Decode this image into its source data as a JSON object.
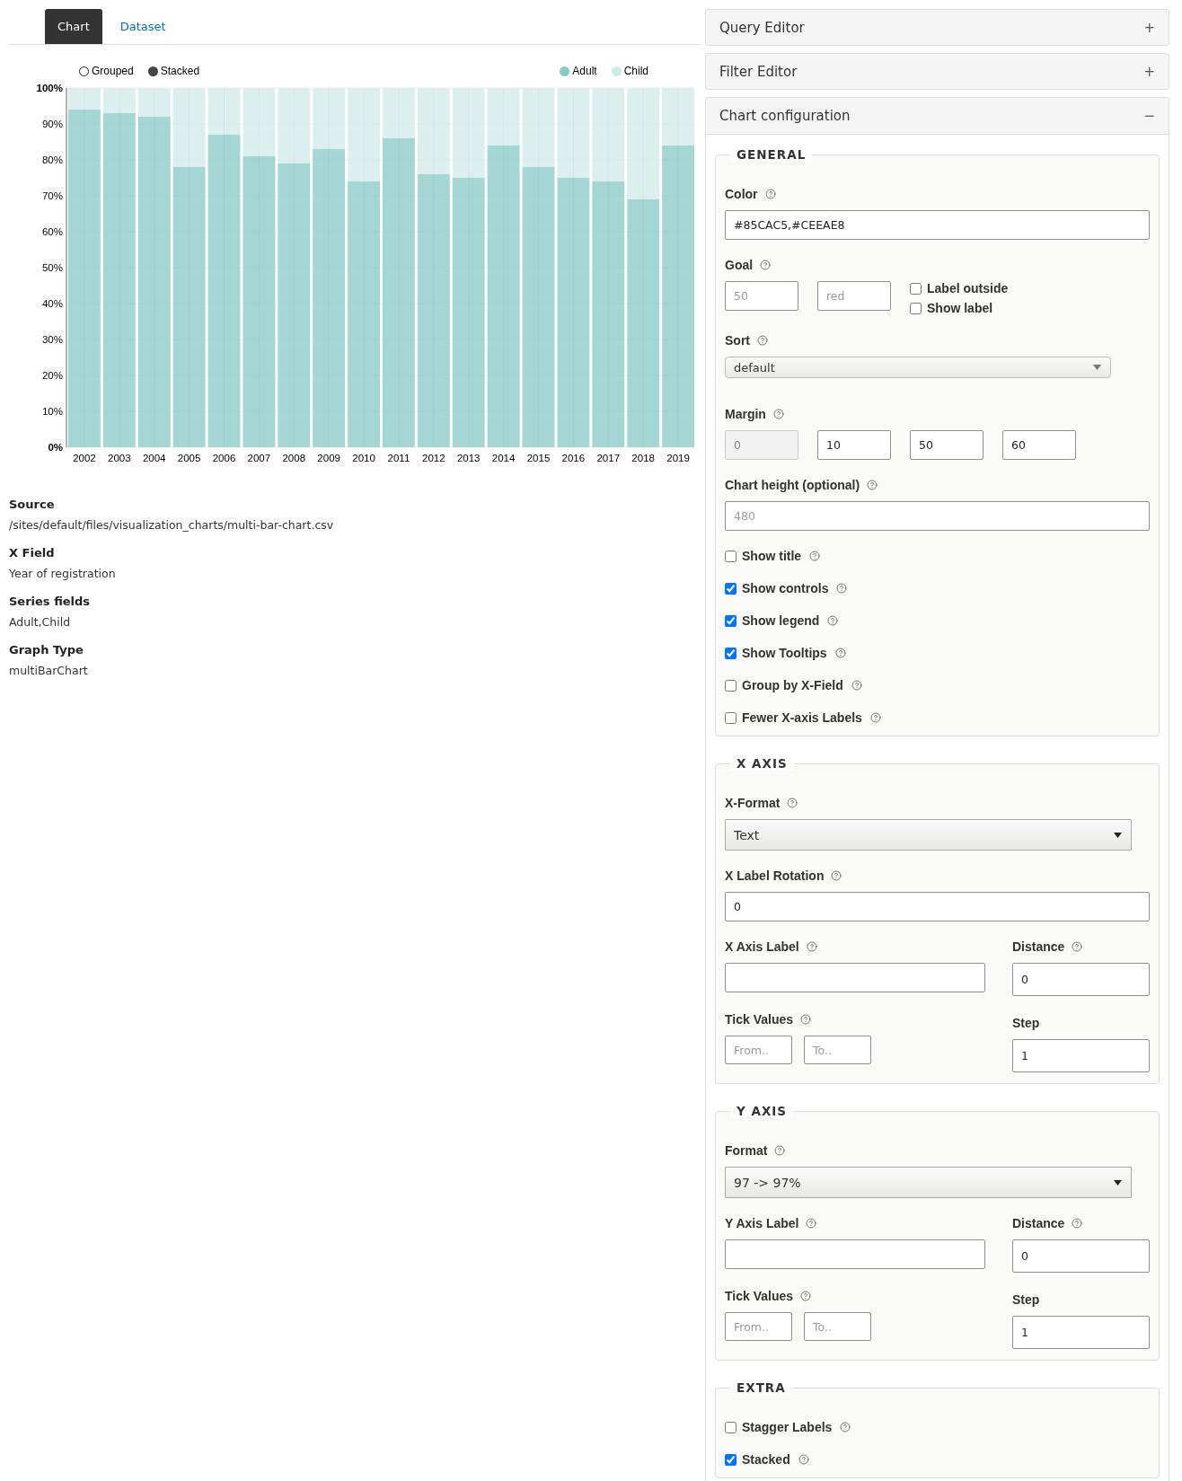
{
  "tabs": [
    {
      "label": "Chart",
      "selected": true
    },
    {
      "label": "Dataset",
      "selected": false
    }
  ],
  "chart": {
    "controls": [
      {
        "label": "Grouped",
        "selected": false
      },
      {
        "label": "Stacked",
        "selected": true
      }
    ],
    "chart_data": {
      "type": "bar",
      "categories": [
        "2002",
        "2003",
        "2004",
        "2005",
        "2006",
        "2007",
        "2008",
        "2009",
        "2010",
        "2011",
        "2012",
        "2013",
        "2014",
        "2015",
        "2016",
        "2017",
        "2018",
        "2019"
      ],
      "series": [
        {
          "name": "Adult",
          "color": "#85cac5",
          "values": [
            94,
            93,
            92,
            78,
            87,
            81,
            79,
            83,
            74,
            86,
            76,
            75,
            84,
            78,
            75,
            74,
            69,
            84
          ]
        },
        {
          "name": "Child",
          "color": "#ceeae8",
          "values": [
            6,
            7,
            8,
            22,
            13,
            19,
            21,
            17,
            26,
            14,
            24,
            25,
            16,
            22,
            25,
            26,
            31,
            16
          ]
        }
      ],
      "stacked": true,
      "grid": true,
      "ylim": [
        0,
        100
      ],
      "yticks": [
        {
          "value": 0,
          "label": "0%"
        },
        {
          "value": 10,
          "label": "10%"
        },
        {
          "value": 20,
          "label": "20%"
        },
        {
          "value": 30,
          "label": "30%"
        },
        {
          "value": 40,
          "label": "40%"
        },
        {
          "value": 50,
          "label": "50%"
        },
        {
          "value": 60,
          "label": "60%"
        },
        {
          "value": 70,
          "label": "70%"
        },
        {
          "value": 80,
          "label": "80%"
        },
        {
          "value": 90,
          "label": "90%"
        },
        {
          "value": 100,
          "label": "100%"
        }
      ]
    }
  },
  "details": [
    {
      "label": "Source",
      "value": "/sites/default/files/visualization_charts/multi-bar-chart.csv"
    },
    {
      "label": "X Field",
      "value": "Year of registration"
    },
    {
      "label": "Series fields",
      "value": "Adult,Child"
    },
    {
      "label": "Graph Type",
      "value": "multiBarChart"
    }
  ],
  "accordions": [
    {
      "title": "Query Editor",
      "toggle": "+",
      "expanded": false
    },
    {
      "title": "Filter Editor",
      "toggle": "+",
      "expanded": false
    },
    {
      "title": "Chart configuration",
      "toggle": "−",
      "expanded": true
    }
  ],
  "sections": [
    {
      "title": "GENERAL",
      "items": [
        {
          "kind": "input",
          "label": "Color",
          "help": true,
          "value": "#85CAC5,#CEEAE8"
        },
        {
          "kind": "goal",
          "label": "Goal",
          "help": true,
          "inputs": [
            {
              "placeholder": "50"
            },
            {
              "placeholder": "red"
            }
          ],
          "checks": [
            {
              "label": "Label outside",
              "checked": false
            },
            {
              "label": "Show label",
              "checked": false
            }
          ]
        },
        {
          "kind": "compact-select",
          "label": "Sort",
          "help": true,
          "value": "default"
        },
        {
          "kind": "margin",
          "label": "Margin",
          "help": true,
          "inputs": [
            {
              "value": "0",
              "disabled": true
            },
            {
              "value": "10",
              "disabled": false
            },
            {
              "value": "50",
              "disabled": false
            },
            {
              "value": "60",
              "disabled": false
            }
          ]
        },
        {
          "kind": "input",
          "label": "Chart height (optional)",
          "help": true,
          "placeholder": "480"
        },
        {
          "kind": "checkbox",
          "label": "Show title",
          "help": true,
          "checked": false
        },
        {
          "kind": "checkbox",
          "label": "Show controls",
          "help": true,
          "checked": true
        },
        {
          "kind": "checkbox",
          "label": "Show legend",
          "help": true,
          "checked": true
        },
        {
          "kind": "checkbox",
          "label": "Show Tooltips",
          "help": true,
          "checked": true
        },
        {
          "kind": "checkbox",
          "label": "Group by X-Field",
          "help": true,
          "checked": false
        },
        {
          "kind": "checkbox",
          "label": "Fewer X-axis Labels",
          "help": true,
          "checked": false
        }
      ]
    },
    {
      "title": "X AXIS",
      "items": [
        {
          "kind": "select",
          "label": "X-Format",
          "help": true,
          "value": "Text"
        },
        {
          "kind": "input",
          "label": "X Label Rotation",
          "help": true,
          "value": "0"
        },
        {
          "kind": "axis",
          "label": {
            "text": "X Axis Label",
            "help": true
          },
          "distance": {
            "text": "Distance",
            "help": true,
            "value": "0"
          },
          "ticks": {
            "text": "Tick Values",
            "help": true,
            "from": {
              "placeholder": "From.."
            },
            "to": {
              "placeholder": "To.."
            }
          },
          "step": {
            "text": "Step",
            "help": false,
            "value": "1"
          }
        }
      ]
    },
    {
      "title": "Y AXIS",
      "items": [
        {
          "kind": "select",
          "label": "Format",
          "help": true,
          "value": "97 -> 97%"
        },
        {
          "kind": "axis",
          "label": {
            "text": "Y Axis Label",
            "help": true
          },
          "distance": {
            "text": "Distance",
            "help": true,
            "value": "0"
          },
          "ticks": {
            "text": "Tick Values",
            "help": true,
            "from": {
              "placeholder": "From.."
            },
            "to": {
              "placeholder": "To.."
            }
          },
          "step": {
            "text": "Step",
            "help": false,
            "value": "1"
          }
        }
      ]
    },
    {
      "title": "EXTRA",
      "items": [
        {
          "kind": "checkbox",
          "label": "Stagger Labels",
          "help": true,
          "checked": false
        },
        {
          "kind": "checkbox",
          "label": "Stacked",
          "help": true,
          "checked": true
        }
      ]
    }
  ]
}
